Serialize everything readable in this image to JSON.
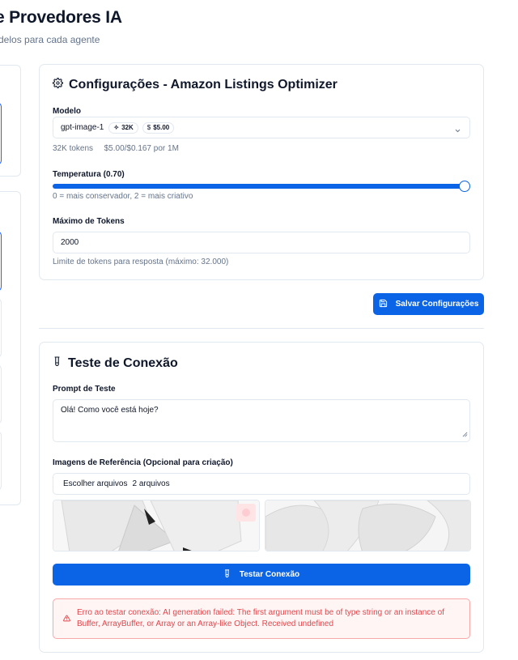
{
  "header": {
    "title": "e Provedores IA",
    "subtitle": "delos para cada agente"
  },
  "config": {
    "title": "Configurações - Amazon Listings Optimizer",
    "model_label": "Modelo",
    "model_name": "gpt-image-1",
    "model_context_chip": "32K",
    "model_price_chip": "$5.00",
    "model_info_tokens": "32K tokens",
    "model_info_price": "$5.00/$0.167 por 1M",
    "temperature_label": "Temperatura (0.70)",
    "temperature_value": 0.7,
    "temperature_help": "0 = mais conservador, 2 = mais criativo",
    "max_tokens_label": "Máximo de Tokens",
    "max_tokens_value": "2000",
    "max_tokens_help": "Limite de tokens para resposta (máximo: 32.000)",
    "save_label": "Salvar Configurações"
  },
  "test": {
    "title": "Teste de Conexão",
    "prompt_label": "Prompt de Teste",
    "prompt_value": "Olá! Como você está hoje?",
    "images_label": "Imagens de Referência (Opcional para criação)",
    "file_button": "Escolher arquivos",
    "file_status": "2 arquivos",
    "test_button": "Testar Conexão",
    "error_message": "Erro ao testar conexão: AI generation failed: The first argument must be of type string or an instance of Buffer, ArrayBuffer, or Array or an Array-like Object. Received undefined"
  },
  "colors": {
    "primary": "#0b63e5",
    "error": "#e0474c",
    "border": "#e2e8f0"
  },
  "icons": {
    "config": "gear-icon",
    "test": "test-tube-icon",
    "save": "save-icon",
    "error": "warning-triangle-icon",
    "select": "chevron-down-icon"
  }
}
